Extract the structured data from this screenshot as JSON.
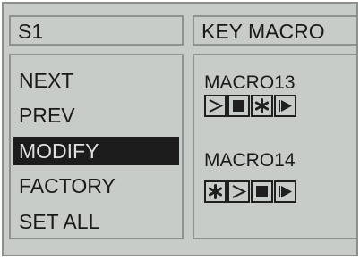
{
  "header": {
    "scene": "S1",
    "mode": "KEY MACRO"
  },
  "menu": {
    "items": [
      {
        "label": "NEXT",
        "selected": false
      },
      {
        "label": "PREV",
        "selected": false
      },
      {
        "label": "MODIFY",
        "selected": true
      },
      {
        "label": "FACTORY",
        "selected": false
      },
      {
        "label": "SET ALL",
        "selected": false
      }
    ]
  },
  "macros": [
    {
      "label": "MACRO13",
      "keys": [
        "next-icon",
        "stop-icon",
        "asterisk-icon",
        "play-icon"
      ]
    },
    {
      "label": "MACRO14",
      "keys": [
        "asterisk-icon",
        "next-icon",
        "stop-icon",
        "play-icon"
      ]
    }
  ],
  "colors": {
    "panel": "#c8ccc8",
    "border": "#8f9390",
    "text": "#1a1a1a",
    "selection": "#1c1c1c",
    "selection_text": "#dfe3df"
  }
}
